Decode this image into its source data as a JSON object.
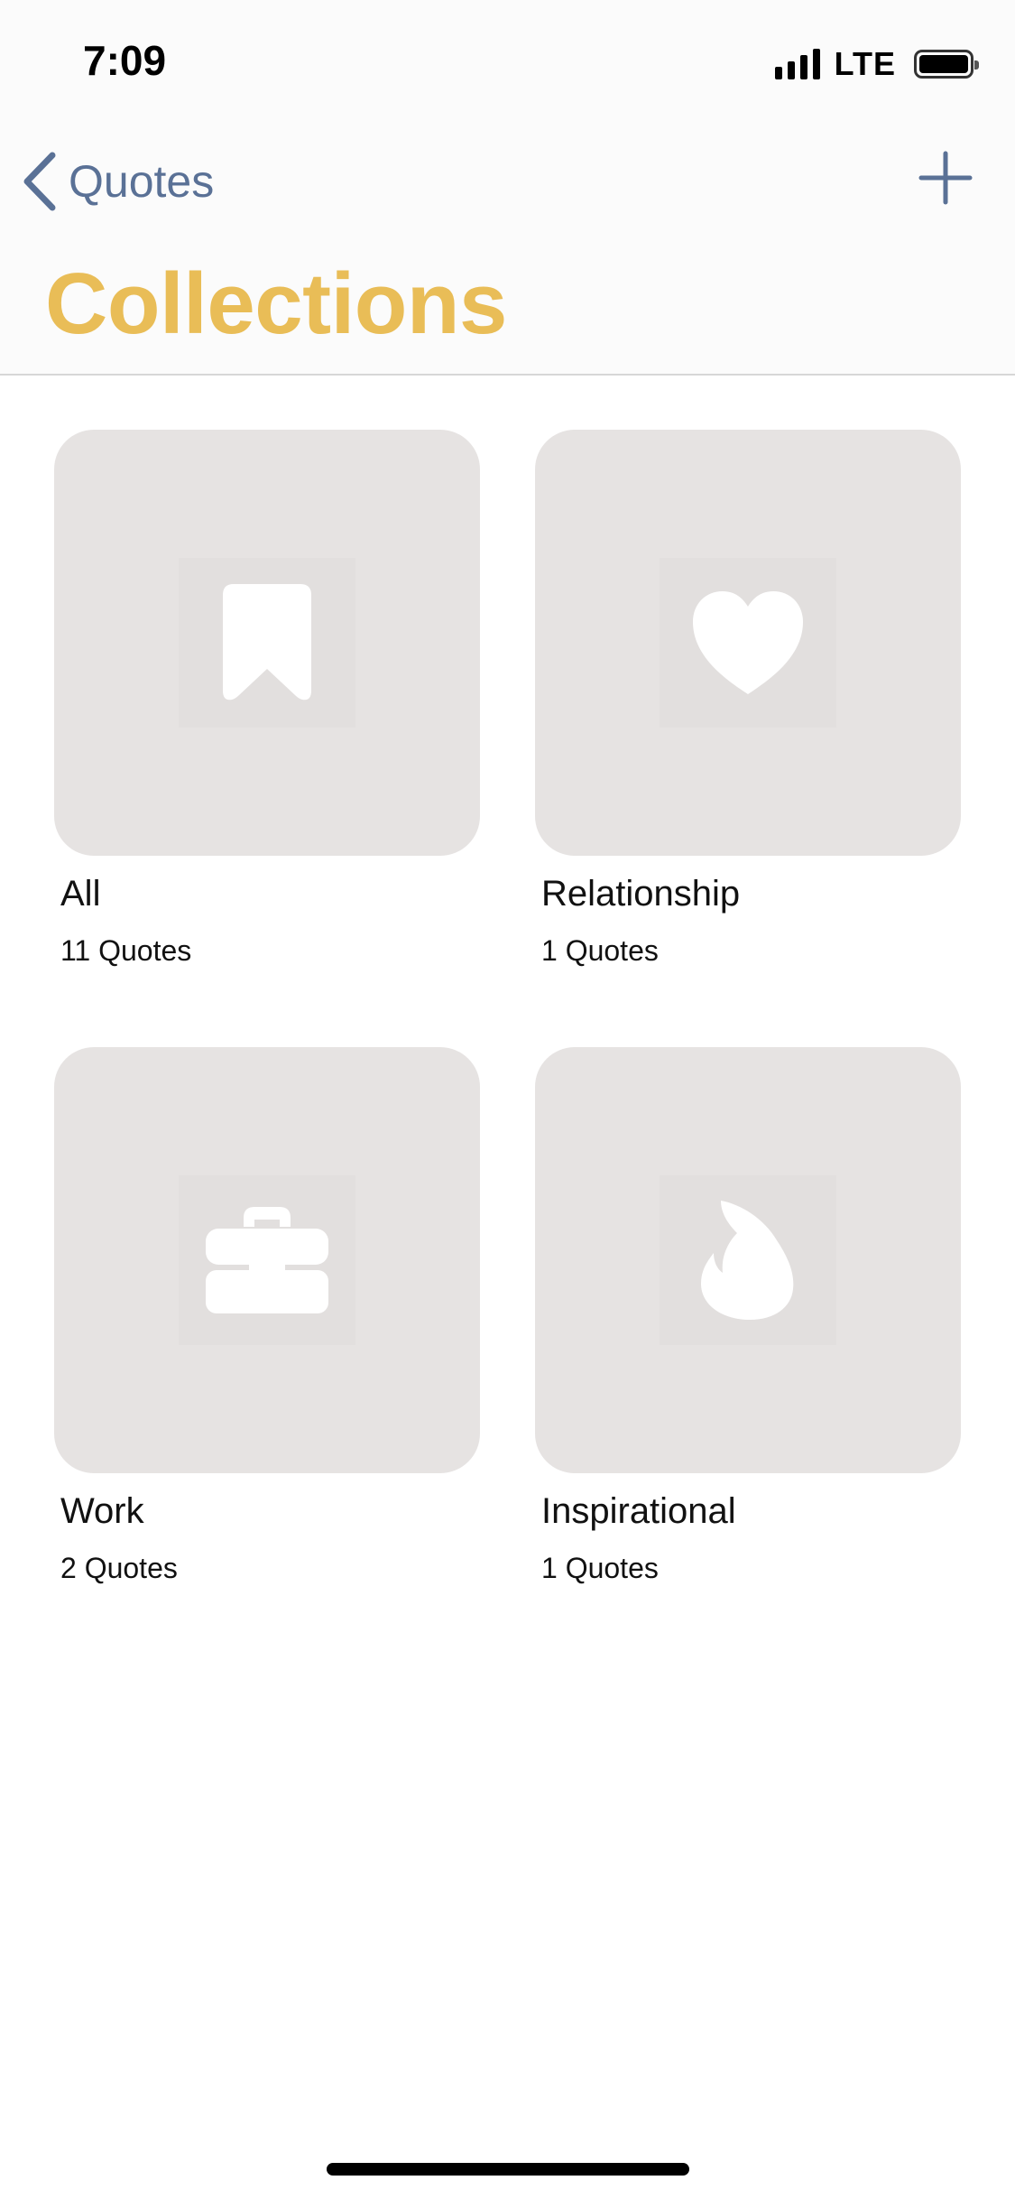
{
  "status_bar": {
    "time": "7:09",
    "network": "LTE"
  },
  "nav": {
    "back_label": "Quotes",
    "title": "Collections"
  },
  "collections": [
    {
      "name": "All",
      "count": "11 Quotes",
      "icon": "bookmark-icon"
    },
    {
      "name": "Relationship",
      "count": "1 Quotes",
      "icon": "heart-icon"
    },
    {
      "name": "Work",
      "count": "2 Quotes",
      "icon": "toolbox-icon"
    },
    {
      "name": "Inspirational",
      "count": "1 Quotes",
      "icon": "flame-icon"
    }
  ],
  "colors": {
    "accent": "#e9bd57",
    "nav_tint": "#5a7196",
    "tile": "#e6e3e2"
  }
}
